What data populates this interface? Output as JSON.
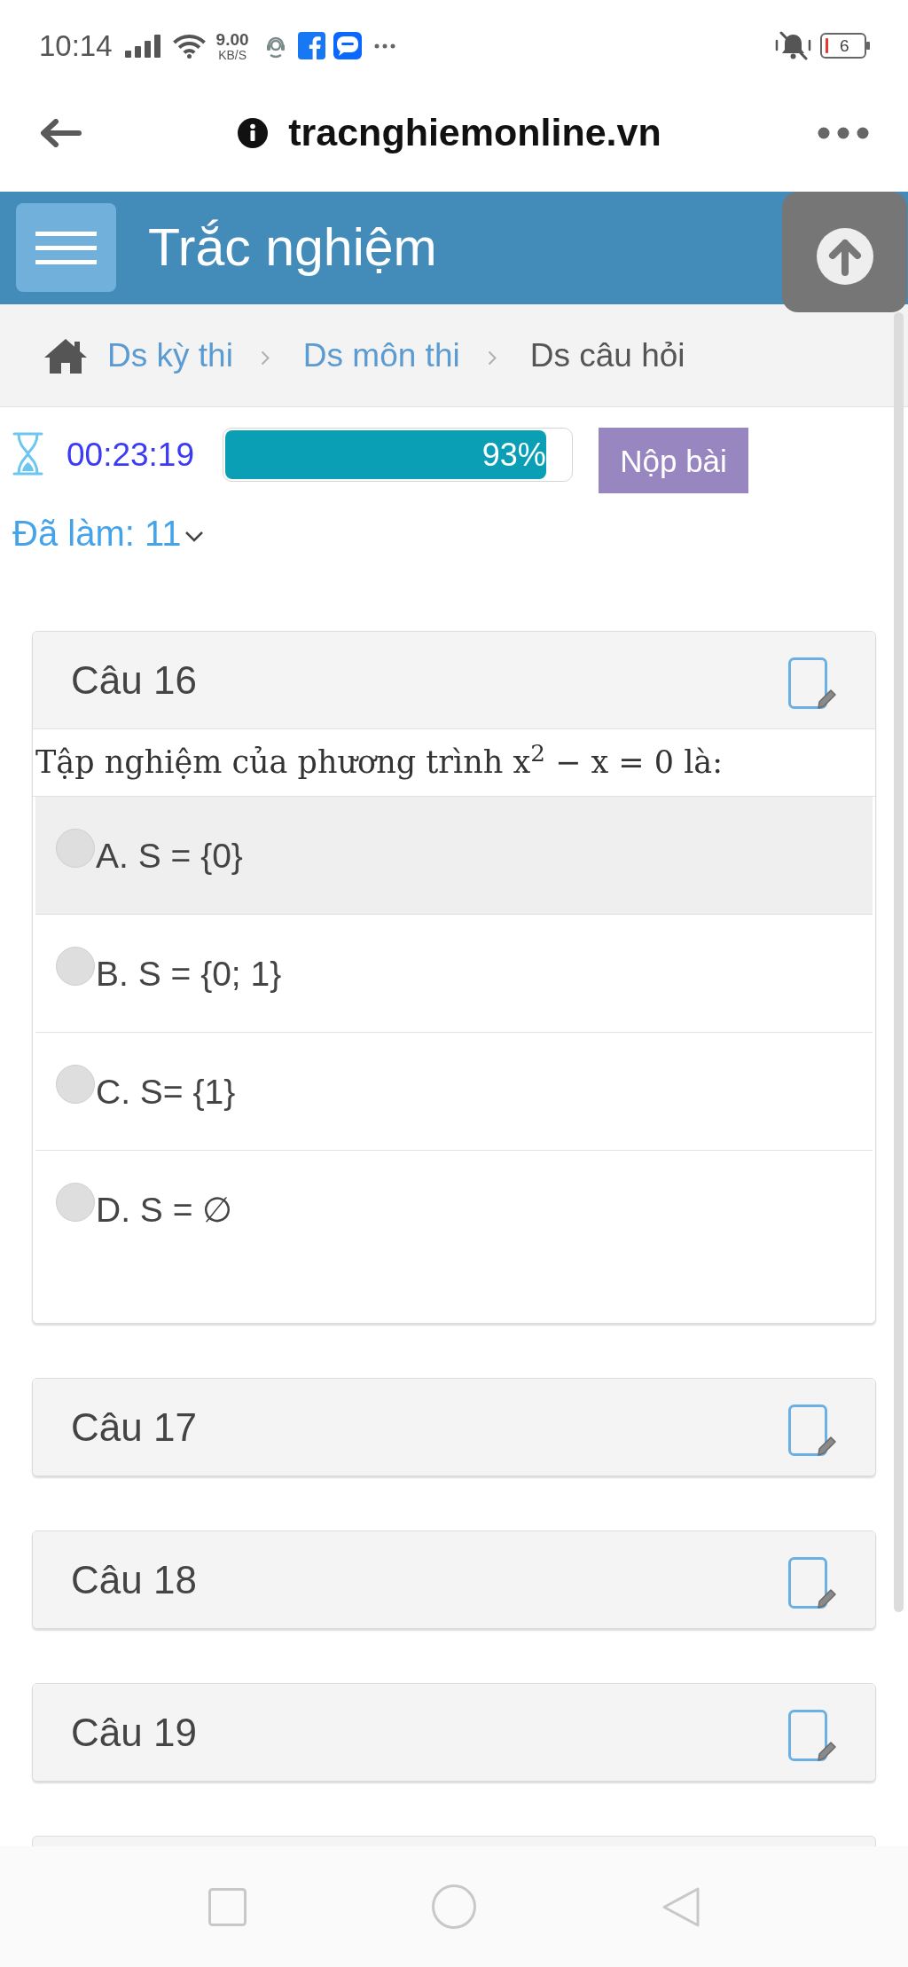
{
  "status_bar": {
    "time": "10:14",
    "net_speed": "9.00",
    "net_unit": "KB/S",
    "battery": "6"
  },
  "browser_bar": {
    "url": "tracnghiemonline.vn"
  },
  "header": {
    "title": "Trắc nghiệm"
  },
  "breadcrumb": [
    {
      "label": "Ds kỳ thi",
      "kind": "link"
    },
    {
      "label": "Ds môn thi",
      "kind": "link"
    },
    {
      "label": "Ds câu hỏi",
      "kind": "current"
    }
  ],
  "exam_bar": {
    "timer": "00:23:19",
    "progress": {
      "level": 0.93,
      "reading": "93%"
    },
    "submit_button": "Nộp bài",
    "done_count": "Đã làm: 11",
    "done_expanded": false
  },
  "questions": [
    {
      "title": "Câu 16",
      "expanded": true,
      "text": "Tập nghiệm của phương trình x$^{2}$ − x = 0 là:",
      "options": [
        {
          "label": "A. S = {0}",
          "selected": false,
          "highlighted": true
        },
        {
          "label": "B. S = {0; 1}",
          "selected": false,
          "highlighted": false
        },
        {
          "label": "C. S= {1}",
          "selected": false,
          "highlighted": false
        },
        {
          "label": "D. S = ∅",
          "selected": false,
          "highlighted": false
        }
      ]
    },
    {
      "title": "Câu 17",
      "expanded": false
    },
    {
      "title": "Câu 18",
      "expanded": false
    },
    {
      "title": "Câu 19",
      "expanded": false
    }
  ],
  "more_questions_below": true
}
